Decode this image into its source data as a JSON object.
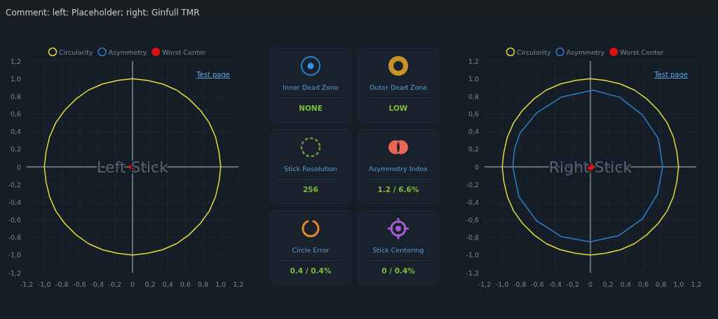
{
  "comment": "Comment: left: Placeholder; right: Ginfull TMR",
  "left_panel": {
    "link": "Test page",
    "chart_data": {
      "type": "line",
      "title": "Left Stick",
      "grid": true,
      "legend": "top",
      "xlim": [
        -1.2,
        1.2
      ],
      "ylim": [
        -1.2,
        1.2
      ],
      "xticks": [
        {
          "value": -1.2,
          "label": "-1,2"
        },
        {
          "value": -1.0,
          "label": "-1,0"
        },
        {
          "value": -0.8,
          "label": "-0,8"
        },
        {
          "value": -0.6,
          "label": "-0,6"
        },
        {
          "value": -0.4,
          "label": "-0,4"
        },
        {
          "value": -0.2,
          "label": "-0,2"
        },
        {
          "value": 0,
          "label": "0"
        },
        {
          "value": 0.2,
          "label": "0,2"
        },
        {
          "value": 0.4,
          "label": "0,4"
        },
        {
          "value": 0.6,
          "label": "0,6"
        },
        {
          "value": 0.8,
          "label": "0,8"
        },
        {
          "value": 1.0,
          "label": "1,0"
        },
        {
          "value": 1.2,
          "label": "1,2"
        }
      ],
      "yticks": [
        {
          "value": 1.2,
          "label": "1,2"
        },
        {
          "value": 1.0,
          "label": "1,0"
        },
        {
          "value": 0.8,
          "label": "0,8"
        },
        {
          "value": 0.6,
          "label": "0,6"
        },
        {
          "value": 0.4,
          "label": "0,4"
        },
        {
          "value": 0.2,
          "label": "0,2"
        },
        {
          "value": 0,
          "label": "0"
        },
        {
          "value": -0.2,
          "label": "-0,2"
        },
        {
          "value": -0.4,
          "label": "-0,4"
        },
        {
          "value": -0.6,
          "label": "-0,6"
        },
        {
          "value": -0.8,
          "label": "-0,8"
        },
        {
          "value": -1.0,
          "label": "-1,0"
        },
        {
          "value": -1.2,
          "label": "-1,2"
        }
      ],
      "series": [
        {
          "name": "Circularity",
          "color": "#e3dc3c",
          "x": [
            -1,
            -0.98,
            -0.94,
            -0.87,
            -0.77,
            -0.64,
            -0.5,
            -0.34,
            -0.17,
            0,
            0.17,
            0.34,
            0.5,
            0.64,
            0.77,
            0.87,
            0.94,
            0.98,
            1,
            null,
            -1,
            -0.98,
            -0.94,
            -0.87,
            -0.77,
            -0.64,
            -0.5,
            -0.34,
            -0.17,
            0,
            0.17,
            0.34,
            0.5,
            0.64,
            0.77,
            0.87,
            0.94,
            0.98,
            1
          ],
          "values": [
            0,
            0.17,
            0.34,
            0.5,
            0.64,
            0.77,
            0.87,
            0.94,
            0.98,
            1,
            0.98,
            0.94,
            0.87,
            0.77,
            0.64,
            0.5,
            0.34,
            0.17,
            0,
            null,
            0,
            -0.17,
            -0.34,
            -0.5,
            -0.64,
            -0.77,
            -0.87,
            -0.94,
            -0.98,
            -1,
            -0.98,
            -0.94,
            -0.87,
            -0.77,
            -0.64,
            -0.5,
            -0.34,
            -0.17,
            0
          ]
        },
        {
          "name": "Asymmetry",
          "color": "#2f7fc8"
        },
        {
          "name": "Worst Center",
          "color": "#e01010",
          "marker": "circle",
          "x": [
            0
          ],
          "values": [
            0
          ]
        }
      ]
    }
  },
  "metrics": [
    {
      "kind": "inner-dead-zone",
      "label": "Inner Dead Zone",
      "value": "NONE"
    },
    {
      "kind": "outer-dead-zone",
      "label": "Outer Dead Zone",
      "value": "LOW"
    },
    {
      "kind": "resolution",
      "label": "Stick Resolution",
      "value": "256"
    },
    {
      "kind": "asymmetry",
      "label": "Asymmetry Index",
      "value": "1.2 / 6.6%"
    },
    {
      "kind": "circle-error",
      "label": "Circle Error",
      "value": "0.4 / 0.4%"
    },
    {
      "kind": "centering",
      "label": "Stick Centering",
      "value": "0 / 0.4%"
    }
  ],
  "right_panel": {
    "link": "Test page",
    "chart_data": {
      "type": "line",
      "title": "Right Stick",
      "grid": true,
      "legend": "top",
      "xlim": [
        -1.2,
        1.2
      ],
      "ylim": [
        -1.2,
        1.2
      ],
      "xticks": [
        {
          "value": -1.2,
          "label": "-1,2"
        },
        {
          "value": -1.0,
          "label": "-1,0"
        },
        {
          "value": -0.8,
          "label": "-0,8"
        },
        {
          "value": -0.6,
          "label": "-0,6"
        },
        {
          "value": -0.4,
          "label": "-0,4"
        },
        {
          "value": -0.2,
          "label": "-0,2"
        },
        {
          "value": 0,
          "label": "0"
        },
        {
          "value": 0.2,
          "label": "0,2"
        },
        {
          "value": 0.4,
          "label": "0,4"
        },
        {
          "value": 0.6,
          "label": "0,6"
        },
        {
          "value": 0.8,
          "label": "0,8"
        },
        {
          "value": 1.0,
          "label": "1,0"
        },
        {
          "value": 1.2,
          "label": "1,2"
        }
      ],
      "yticks": [
        {
          "value": 1.2,
          "label": "1,2"
        },
        {
          "value": 1.0,
          "label": "1,0"
        },
        {
          "value": 0.8,
          "label": "0,8"
        },
        {
          "value": 0.6,
          "label": "0,6"
        },
        {
          "value": 0.4,
          "label": "0,4"
        },
        {
          "value": 0.2,
          "label": "0,2"
        },
        {
          "value": 0,
          "label": "0"
        },
        {
          "value": -0.2,
          "label": "-0,2"
        },
        {
          "value": -0.4,
          "label": "-0,4"
        },
        {
          "value": -0.6,
          "label": "-0,6"
        },
        {
          "value": -0.8,
          "label": "-0,8"
        },
        {
          "value": -1.0,
          "label": "-1,0"
        },
        {
          "value": -1.2,
          "label": "-1,2"
        }
      ],
      "series": [
        {
          "name": "Circularity",
          "color": "#e3dc3c",
          "x": [
            -1,
            -0.98,
            -0.94,
            -0.87,
            -0.77,
            -0.64,
            -0.5,
            -0.34,
            -0.17,
            0,
            0.17,
            0.34,
            0.5,
            0.64,
            0.77,
            0.87,
            0.94,
            0.98,
            1,
            null,
            -1,
            -0.98,
            -0.94,
            -0.87,
            -0.77,
            -0.64,
            -0.5,
            -0.34,
            -0.17,
            0,
            0.17,
            0.34,
            0.5,
            0.64,
            0.77,
            0.87,
            0.94,
            0.98,
            1
          ],
          "values": [
            0,
            0.17,
            0.34,
            0.5,
            0.64,
            0.77,
            0.87,
            0.94,
            0.98,
            1,
            0.98,
            0.94,
            0.87,
            0.77,
            0.64,
            0.5,
            0.34,
            0.17,
            0,
            null,
            0,
            -0.17,
            -0.34,
            -0.5,
            -0.64,
            -0.77,
            -0.87,
            -0.94,
            -0.98,
            -1,
            -0.98,
            -0.94,
            -0.87,
            -0.77,
            -0.64,
            -0.5,
            -0.34,
            -0.17,
            0
          ]
        },
        {
          "name": "Asymmetry",
          "color": "#2f7fc8",
          "x": [
            -0.88,
            -0.86,
            -0.8,
            -0.61,
            -0.33,
            0.03,
            0.33,
            0.59,
            0.77,
            0.82,
            null,
            -0.88,
            -0.81,
            -0.61,
            -0.33,
            0,
            0.32,
            0.59,
            0.76,
            0.82
          ],
          "values": [
            0,
            0.2,
            0.38,
            0.61,
            0.79,
            0.87,
            0.79,
            0.59,
            0.32,
            0,
            null,
            0,
            -0.34,
            -0.61,
            -0.79,
            -0.85,
            -0.78,
            -0.59,
            -0.31,
            0
          ]
        },
        {
          "name": "Worst Center",
          "color": "#e01010",
          "marker": "circle",
          "x": [
            0
          ],
          "values": [
            0
          ]
        }
      ]
    }
  }
}
